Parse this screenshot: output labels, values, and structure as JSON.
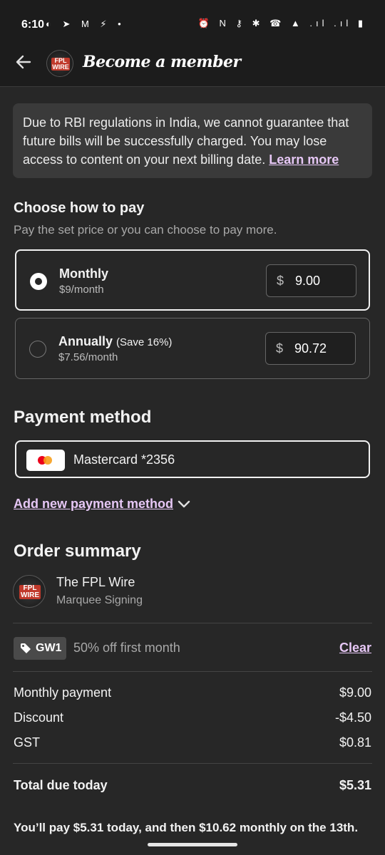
{
  "status_bar": {
    "time": "6:10",
    "left_icons": "◐ ➤ M ⚡ •",
    "right_icons": "⏰ N ⚷ ✱ ☎ ▲ .ıl .ıl ▮"
  },
  "header": {
    "title": "Become a member",
    "logo_text": "FPL WIRE"
  },
  "notice": {
    "text": "Due to RBI regulations in India, we cannot guarantee that future bills will be successfully charged. You may lose access to content on your next billing date.",
    "link": "Learn more"
  },
  "pricing": {
    "heading": "Choose how to pay",
    "subheading": "Pay the set price or you can choose to pay more.",
    "plans": [
      {
        "name": "Monthly",
        "save": "",
        "price": "$9/month",
        "currency": "$",
        "amount": "9.00",
        "selected": true
      },
      {
        "name": "Annually",
        "save": "(Save 16%)",
        "price": "$7.56/month",
        "currency": "$",
        "amount": "90.72",
        "selected": false
      }
    ]
  },
  "payment": {
    "heading": "Payment method",
    "card_label": "Mastercard *2356",
    "add_label": "Add new payment method"
  },
  "order": {
    "heading": "Order summary",
    "publication": "The FPL Wire",
    "tier": "Marquee Signing",
    "logo_text": "FPL WIRE",
    "coupon_code": "GW1",
    "coupon_desc": "50% off first month",
    "clear_label": "Clear",
    "lines": [
      {
        "label": "Monthly payment",
        "value": "$9.00"
      },
      {
        "label": "Discount",
        "value": "-$4.50"
      },
      {
        "label": "GST",
        "value": "$0.81"
      }
    ],
    "total_label": "Total due today",
    "total_value": "$5.31",
    "footnote": "You’ll pay $5.31 today, and then $10.62 monthly on the 13th."
  },
  "colors": {
    "background": "#272727",
    "link_accent": "#e6c7f5",
    "brand_red": "#c0392b"
  }
}
